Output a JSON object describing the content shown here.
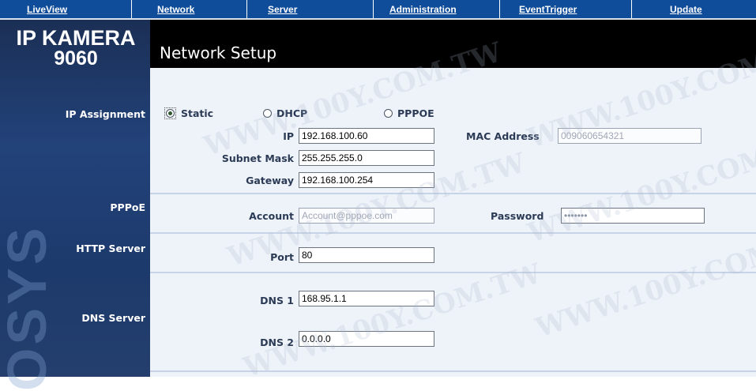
{
  "nav": {
    "items": [
      {
        "label": "LiveView"
      },
      {
        "label": "Network"
      },
      {
        "label": "Server"
      },
      {
        "label": "Administration"
      },
      {
        "label": "EventTrigger"
      },
      {
        "label": "Update"
      }
    ]
  },
  "brand": {
    "line1": "IP KAMERA",
    "line2": "9060",
    "decoration": "OSYS"
  },
  "sidebar": {
    "ip_assignment": "IP Assignment",
    "pppoe": "PPPoE",
    "http_server": "HTTP Server",
    "dns_server": "DNS Server"
  },
  "page_title": "Network Setup",
  "ip_assignment": {
    "options": [
      {
        "label": "Static",
        "selected": true
      },
      {
        "label": "DHCP",
        "selected": false
      },
      {
        "label": "PPPOE",
        "selected": false
      }
    ],
    "ip_label": "IP",
    "ip_value": "192.168.100.60",
    "subnet_label": "Subnet Mask",
    "subnet_value": "255.255.255.0",
    "gateway_label": "Gateway",
    "gateway_value": "192.168.100.254",
    "mac_label": "MAC Address",
    "mac_value": "009060654321"
  },
  "pppoe": {
    "account_label": "Account",
    "account_value": "Account@pppoe.com",
    "password_label": "Password",
    "password_value": "•••••••"
  },
  "http": {
    "port_label": "Port",
    "port_value": "80"
  },
  "dns": {
    "dns1_label": "DNS 1",
    "dns1_value": "168.95.1.1",
    "dns2_label": "DNS 2",
    "dns2_value": "0.0.0.0"
  },
  "watermark": "WWW.100Y.COM.TW",
  "colors": {
    "nav": "#0f4c9a",
    "header": "#000000",
    "panel": "#eef3fa",
    "sidebar": "#22427a"
  }
}
